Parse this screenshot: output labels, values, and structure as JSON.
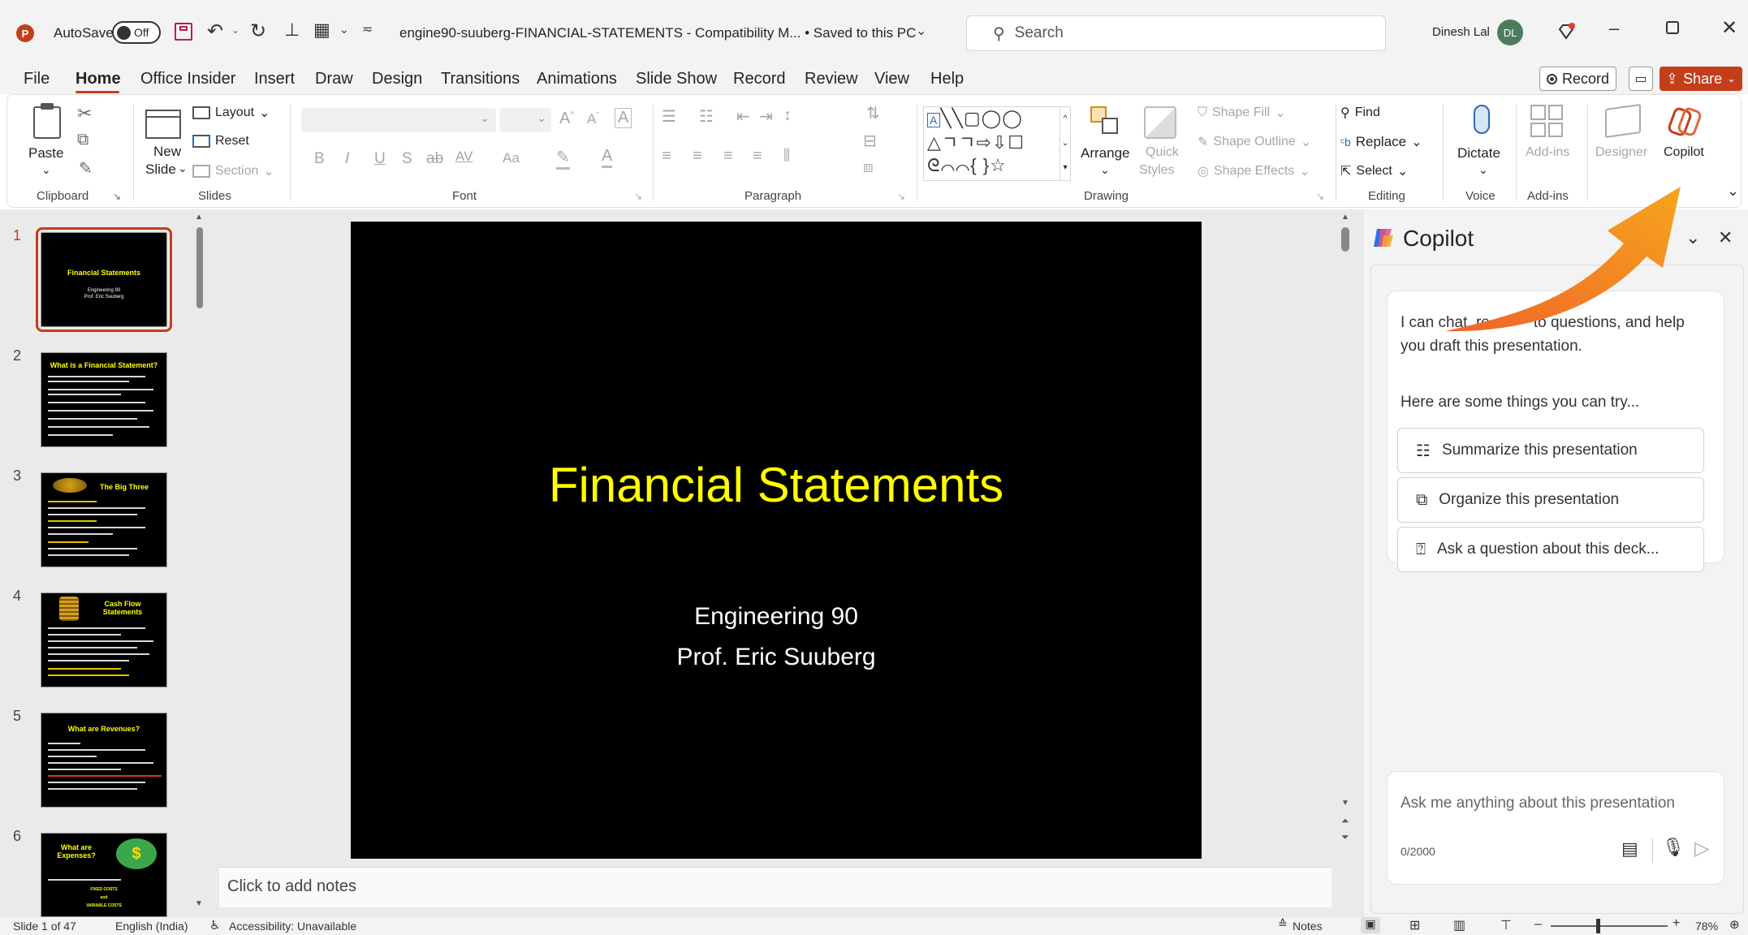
{
  "titlebar": {
    "autosave_label": "AutoSave",
    "autosave_state": "Off",
    "doc_title": "engine90-suuberg-FINANCIAL-STATEMENTS  -  Compatibility M...  •  Saved to this PC",
    "search_placeholder": "Search",
    "user_name": "Dinesh Lal",
    "user_initials": "DL"
  },
  "menu": [
    "File",
    "Home",
    "Office Insider",
    "Insert",
    "Draw",
    "Design",
    "Transitions",
    "Animations",
    "Slide Show",
    "Record",
    "Review",
    "View",
    "Help"
  ],
  "menu_active": "Home",
  "menu_right": {
    "record": "Record",
    "share": "Share"
  },
  "ribbon": {
    "clipboard": {
      "paste": "Paste",
      "label": "Clipboard"
    },
    "slides": {
      "new_slide_1": "New",
      "new_slide_2": "Slide",
      "layout": "Layout",
      "reset": "Reset",
      "section": "Section",
      "label": "Slides"
    },
    "font": {
      "label": "Font",
      "bold": "B",
      "italic": "I",
      "underline": "U",
      "strike": "S",
      "spacing": "AV",
      "case": "Aa",
      "grow": "A^",
      "shrink": "A^"
    },
    "paragraph": {
      "label": "Paragraph"
    },
    "drawing": {
      "arrange": "Arrange",
      "quick_styles_1": "Quick",
      "quick_styles_2": "Styles",
      "shape_fill": "Shape Fill",
      "shape_outline": "Shape Outline",
      "shape_effects": "Shape Effects",
      "label": "Drawing"
    },
    "editing": {
      "find": "Find",
      "replace": "Replace",
      "select": "Select",
      "label": "Editing"
    },
    "voice": {
      "dictate": "Dictate",
      "label": "Voice"
    },
    "addins": {
      "addins": "Add-ins",
      "designer": "Designer",
      "copilot": "Copilot",
      "label": "Add-ins"
    }
  },
  "thumbnails": [
    {
      "num": "1",
      "title": "Financial Statements",
      "sub1": "Engineering 90",
      "sub2": "Prof. Eric Suuberg"
    },
    {
      "num": "2",
      "title": "What is a Financial Statement?"
    },
    {
      "num": "3",
      "title": "The Big Three"
    },
    {
      "num": "4",
      "title": "Cash Flow Statements"
    },
    {
      "num": "5",
      "title": "What are Revenues?"
    },
    {
      "num": "6",
      "title": "What are Expenses?",
      "extra1": "FIXED COSTS",
      "extra2": "and",
      "extra3": "VARIABLE COSTS"
    }
  ],
  "slide": {
    "title": "Financial Statements",
    "line1": "Engineering 90",
    "line2": "Prof. Eric Suuberg",
    "title_color": "#FFFF00",
    "bg_color": "#000000"
  },
  "notes_placeholder": "Click to add notes",
  "copilot": {
    "title": "Copilot",
    "intro": "I can chat, answer questions, and help you draft this presentation.",
    "intro_visible_a": "I can chat, re",
    "intro_visible_b": "to questions, and help",
    "intro_visible_c": "you draft this presentation.",
    "try_label": "Here are some things you can try...",
    "suggestions": [
      "Summarize this presentation",
      "Organize this presentation",
      "Ask a question about this deck..."
    ],
    "input_placeholder": "Ask me anything about this presentation",
    "char_count": "0/2000"
  },
  "status": {
    "slide_info": "Slide 1 of 47",
    "language": "English (India)",
    "accessibility": "Accessibility: Unavailable",
    "notes": "Notes",
    "zoom": "78%"
  },
  "colors": {
    "accent": "#C43E1C",
    "arrow": "#F39C12"
  }
}
